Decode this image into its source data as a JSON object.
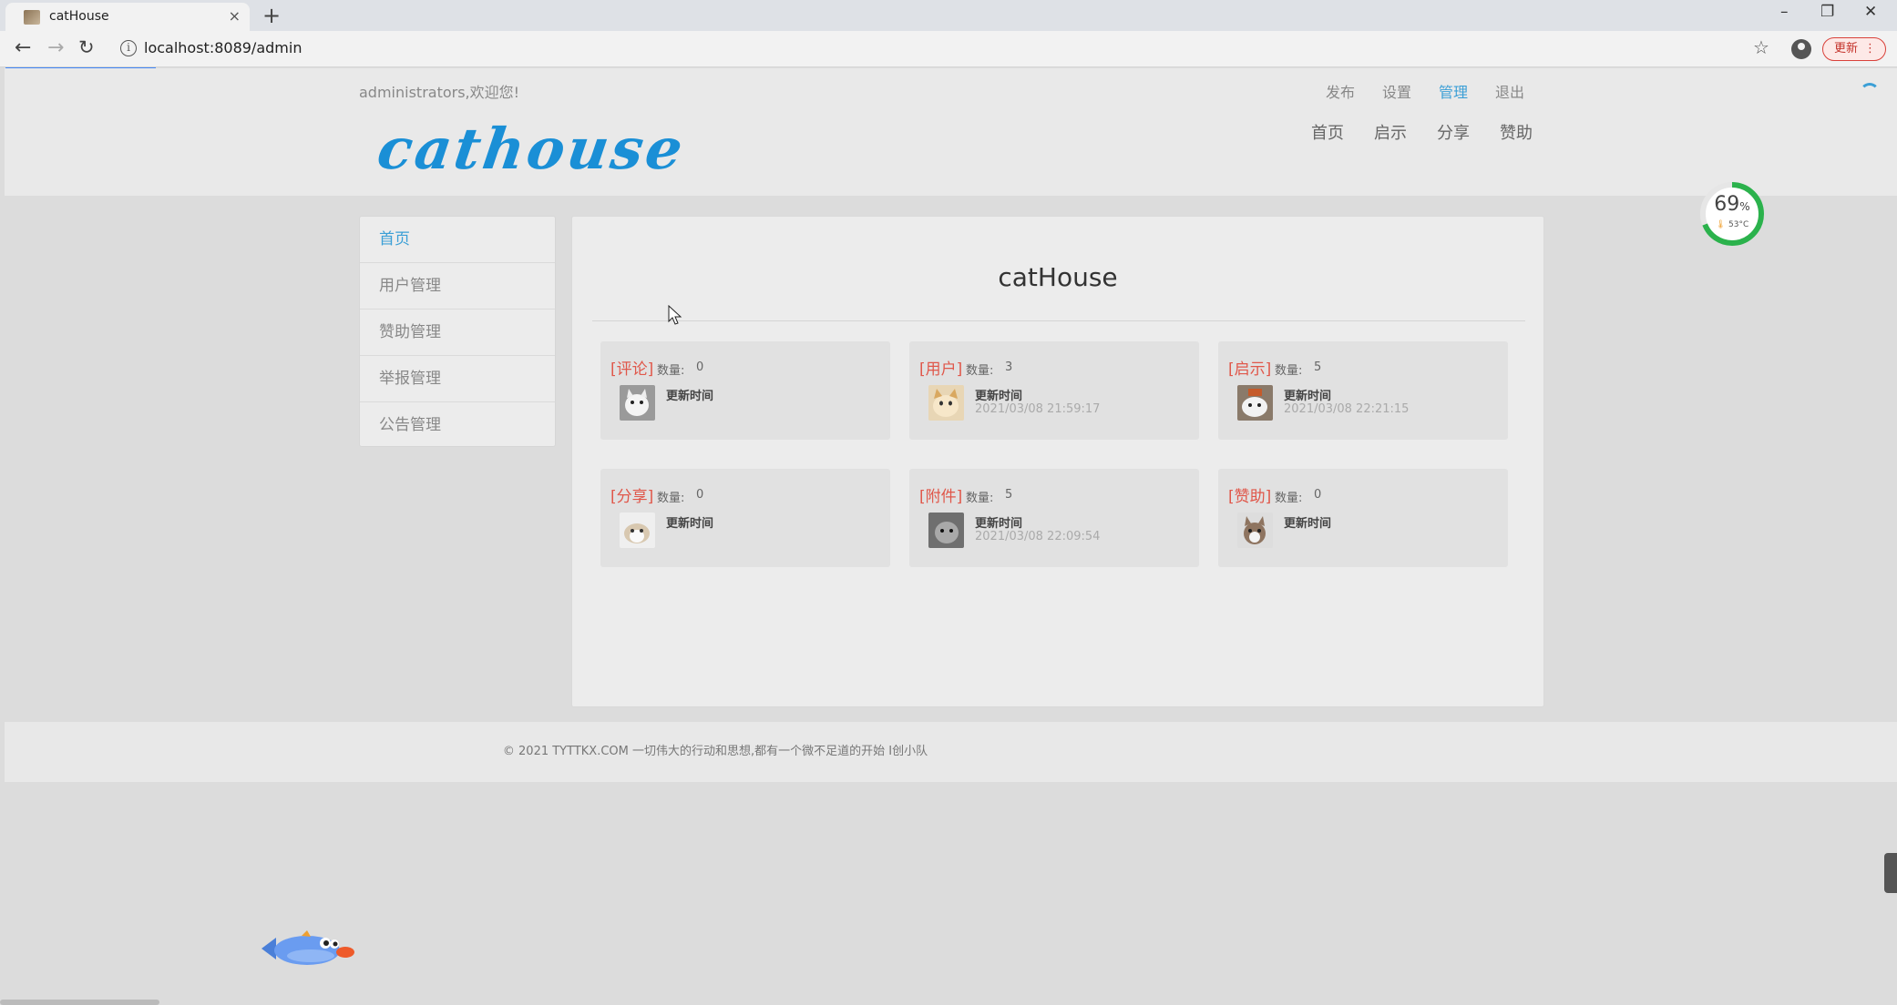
{
  "browser": {
    "tab_title": "catHouse",
    "tab_close": "×",
    "new_tab": "+",
    "url": "localhost:8089/admin",
    "update_label": "更新",
    "window_controls": {
      "minimize": "–",
      "restore": "❐",
      "close": "✕"
    }
  },
  "header": {
    "welcome": "administrators,欢迎您!",
    "top_links": [
      "发布",
      "设置",
      "管理",
      "退出"
    ],
    "active_top_link": "管理",
    "main_nav": [
      "首页",
      "启示",
      "分享",
      "赞助"
    ],
    "logo": "cathouse"
  },
  "sidebar": {
    "items": [
      {
        "label": "首页",
        "active": true
      },
      {
        "label": "用户管理",
        "active": false
      },
      {
        "label": "赞助管理",
        "active": false
      },
      {
        "label": "举报管理",
        "active": false
      },
      {
        "label": "公告管理",
        "active": false
      }
    ]
  },
  "main": {
    "title": "catHouse",
    "count_label": "数量:",
    "update_label": "更新时间",
    "cards": [
      {
        "tag": "[评论]",
        "count": "0",
        "updated": ""
      },
      {
        "tag": "[用户]",
        "count": "3",
        "updated": "2021/03/08 21:59:17"
      },
      {
        "tag": "[启示]",
        "count": "5",
        "updated": "2021/03/08 22:21:15"
      },
      {
        "tag": "[分享]",
        "count": "0",
        "updated": ""
      },
      {
        "tag": "[附件]",
        "count": "5",
        "updated": "2021/03/08 22:09:54"
      },
      {
        "tag": "[赞助]",
        "count": "0",
        "updated": ""
      }
    ]
  },
  "footer": {
    "text": "© 2021 TYTTKX.COM   一切伟大的行动和思想,都有一个微不足道的开始    I创小队"
  },
  "widget": {
    "percent": "69",
    "percent_unit": "%",
    "temperature": "53°C",
    "percent_value": 0.69,
    "ring_color": "#2bb24c"
  },
  "colors": {
    "accent": "#3b9fd6",
    "tag_red": "#e0574a",
    "logo_blue": "#1a8fd6"
  }
}
